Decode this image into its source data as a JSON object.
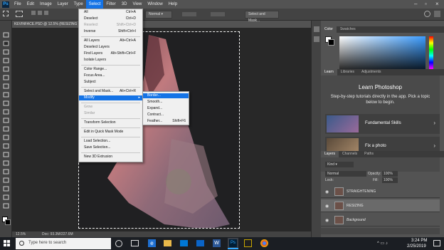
{
  "menubar": {
    "items": [
      "File",
      "Edit",
      "Image",
      "Layer",
      "Type",
      "Select",
      "Filter",
      "3D",
      "View",
      "Window",
      "Help"
    ],
    "active_index": 5
  },
  "optbar": {
    "style_value": "Normal",
    "select_mask_label": "Select and Mask..."
  },
  "doc": {
    "tab_title": "KEVINFACE.PSD @ 12.5% (RESIZING",
    "zoom": "12.5%",
    "doc_size": "Doc: 93.3M/227.6M"
  },
  "select_menu": {
    "items": [
      {
        "label": "All",
        "shortcut": "Ctrl+A",
        "disabled": false
      },
      {
        "label": "Deselect",
        "shortcut": "Ctrl+D",
        "disabled": false
      },
      {
        "label": "Reselect",
        "shortcut": "Shift+Ctrl+D",
        "disabled": true
      },
      {
        "label": "Inverse",
        "shortcut": "Shift+Ctrl+I",
        "disabled": false
      },
      {
        "label": "All Layers",
        "shortcut": "Alt+Ctrl+A",
        "disabled": false
      },
      {
        "label": "Deselect Layers",
        "shortcut": "",
        "disabled": false
      },
      {
        "label": "Find Layers",
        "shortcut": "Alt+Shift+Ctrl+F",
        "disabled": false
      },
      {
        "label": "Isolate Layers",
        "shortcut": "",
        "disabled": false
      },
      {
        "label": "Color Range...",
        "shortcut": "",
        "disabled": false
      },
      {
        "label": "Focus Area...",
        "shortcut": "",
        "disabled": false
      },
      {
        "label": "Subject",
        "shortcut": "",
        "disabled": false
      },
      {
        "label": "Select and Mask...",
        "shortcut": "Alt+Ctrl+R",
        "disabled": false
      },
      {
        "label": "Modify",
        "shortcut": "",
        "disabled": false
      },
      {
        "label": "Grow",
        "shortcut": "",
        "disabled": true
      },
      {
        "label": "Similar",
        "shortcut": "",
        "disabled": true
      },
      {
        "label": "Transform Selection",
        "shortcut": "",
        "disabled": false
      },
      {
        "label": "Edit in Quick Mask Mode",
        "shortcut": "",
        "disabled": false
      },
      {
        "label": "Load Selection...",
        "shortcut": "",
        "disabled": false
      },
      {
        "label": "Save Selection...",
        "shortcut": "",
        "disabled": false
      },
      {
        "label": "New 3D Extrusion",
        "shortcut": "",
        "disabled": false
      }
    ]
  },
  "modify_menu": {
    "items": [
      {
        "label": "Border...",
        "shortcut": ""
      },
      {
        "label": "Smooth...",
        "shortcut": ""
      },
      {
        "label": "Expand...",
        "shortcut": ""
      },
      {
        "label": "Contract...",
        "shortcut": ""
      },
      {
        "label": "Feather...",
        "shortcut": "Shift+F6"
      }
    ]
  },
  "color_panel": {
    "tabs": [
      "Color",
      "Swatches"
    ]
  },
  "learn_panel": {
    "tabs": [
      "Learn",
      "Libraries",
      "Adjustments"
    ],
    "title": "Learn Photoshop",
    "description": "Step-by-step tutorials directly in the app. Pick a topic below to begin.",
    "cards": [
      "Fundamental Skills",
      "Fix a photo"
    ]
  },
  "layers_panel": {
    "tabs": [
      "Layers",
      "Channels",
      "Paths"
    ],
    "kind_label": "Kind",
    "blend_mode": "Normal",
    "opacity_label": "Opacity:",
    "opacity_value": "100%",
    "lock_label": "Lock:",
    "fill_label": "Fill:",
    "fill_value": "100%",
    "layers": [
      {
        "name": "STRAIGHTENING",
        "selected": false
      },
      {
        "name": "RESIZING",
        "selected": true
      },
      {
        "name": "Background",
        "selected": false
      }
    ]
  },
  "taskbar": {
    "search_placeholder": "Type here to search",
    "time": "3:24 PM",
    "date": "2/25/2019"
  }
}
